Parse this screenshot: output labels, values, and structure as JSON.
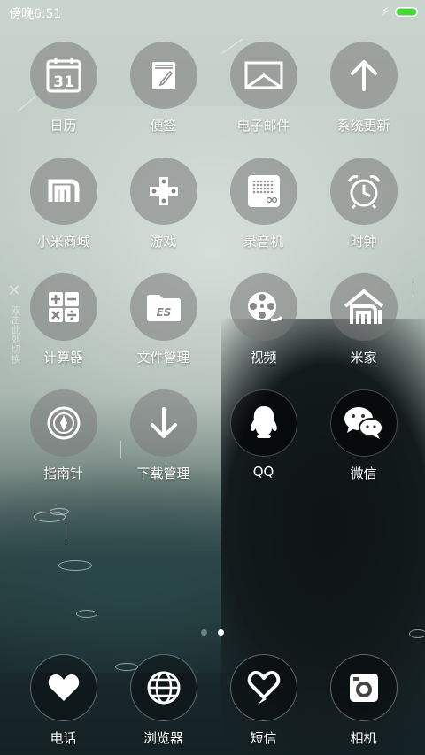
{
  "status": {
    "time": "傍晚6:51",
    "battery_level": 1.0,
    "battery_color": "#3ddc2e"
  },
  "side_hint": {
    "text": "双击此处切换"
  },
  "apps": [
    {
      "label": "日历",
      "icon": "calendar-icon",
      "calendar_day": "31"
    },
    {
      "label": "便签",
      "icon": "notes-icon"
    },
    {
      "label": "电子邮件",
      "icon": "mail-icon"
    },
    {
      "label": "系统更新",
      "icon": "update-arrow-icon"
    },
    {
      "label": "小米商城",
      "icon": "mi-store-icon"
    },
    {
      "label": "游戏",
      "icon": "gamepad-icon"
    },
    {
      "label": "录音机",
      "icon": "recorder-icon"
    },
    {
      "label": "时钟",
      "icon": "alarm-clock-icon"
    },
    {
      "label": "计算器",
      "icon": "calculator-icon"
    },
    {
      "label": "文件管理",
      "icon": "folder-icon",
      "folder_badge": "ES"
    },
    {
      "label": "视频",
      "icon": "film-reel-icon"
    },
    {
      "label": "米家",
      "icon": "mi-home-icon"
    },
    {
      "label": "指南针",
      "icon": "compass-icon"
    },
    {
      "label": "下载管理",
      "icon": "download-icon"
    },
    {
      "label": "QQ",
      "icon": "qq-penguin-icon"
    },
    {
      "label": "微信",
      "icon": "wechat-icon"
    }
  ],
  "pager": {
    "page_count": 2,
    "current_page": 2
  },
  "dock": [
    {
      "label": "电话",
      "icon": "heart-phone-icon"
    },
    {
      "label": "浏览器",
      "icon": "globe-icon"
    },
    {
      "label": "短信",
      "icon": "heart-message-icon"
    },
    {
      "label": "相机",
      "icon": "camera-icon"
    }
  ]
}
